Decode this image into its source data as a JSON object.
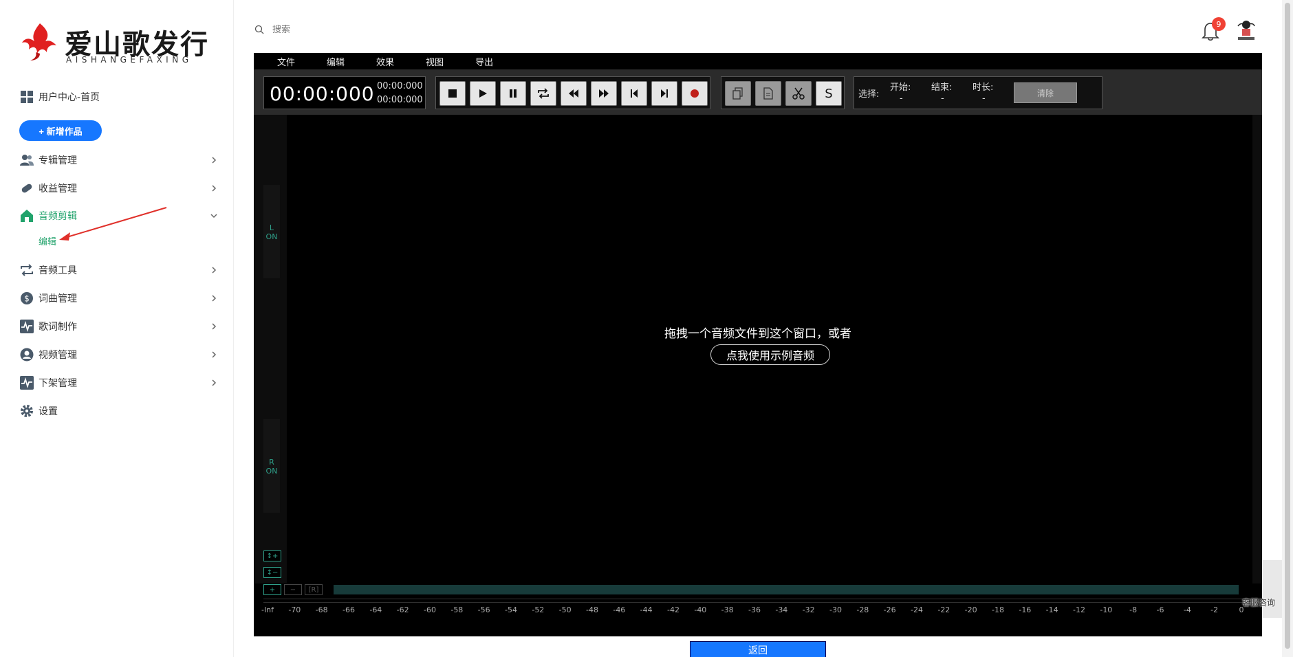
{
  "logo": {
    "title": "爱山歌发行",
    "subtitle": "AISHANGEFAXING"
  },
  "search": {
    "placeholder": "搜索"
  },
  "notifications": {
    "count": "9"
  },
  "sidebar": {
    "home": "用户中心-首页",
    "new_work": "+ 新增作品",
    "items": [
      {
        "label": "专辑管理"
      },
      {
        "label": "收益管理"
      },
      {
        "label": "音频剪辑"
      },
      {
        "label": "音频工具"
      },
      {
        "label": "词曲管理"
      },
      {
        "label": "歌词制作"
      },
      {
        "label": "视频管理"
      },
      {
        "label": "下架管理"
      },
      {
        "label": "设置"
      }
    ],
    "sub_item": "编辑"
  },
  "editor": {
    "menu": [
      "文件",
      "编辑",
      "效果",
      "视图",
      "导出"
    ],
    "time_main": "00:00:000",
    "time_start": "00:00:000",
    "time_end": "00:00:000",
    "selection_label": "选择:",
    "start_label": "开始:",
    "end_label": "结束:",
    "duration_label": "时长:",
    "start_value": "-",
    "end_value": "-",
    "duration_value": "-",
    "clear_label": "清除",
    "s_label": "S",
    "channel_left": [
      "L",
      "ON"
    ],
    "channel_right": [
      "R",
      "ON"
    ],
    "drop_text": "拖拽一个音频文件到这个窗口，或者",
    "sample_label": "点我使用示例音频",
    "zoom_in": "↕+",
    "zoom_out": "↕−",
    "h_plus": "+",
    "h_minus": "−",
    "reset": "[R]",
    "scale": [
      "-Inf",
      "-70",
      "-68",
      "-66",
      "-64",
      "-62",
      "-60",
      "-58",
      "-56",
      "-54",
      "-52",
      "-50",
      "-48",
      "-46",
      "-44",
      "-42",
      "-40",
      "-38",
      "-36",
      "-34",
      "-32",
      "-30",
      "-28",
      "-26",
      "-24",
      "-22",
      "-20",
      "-18",
      "-16",
      "-14",
      "-12",
      "-10",
      "-8",
      "-6",
      "-4",
      "-2",
      "0"
    ]
  },
  "back_label": "返回",
  "service_label": "客服咨询",
  "colors": {
    "accent": "#22a36c",
    "primary": "#1677ff",
    "badge": "#f04134"
  }
}
